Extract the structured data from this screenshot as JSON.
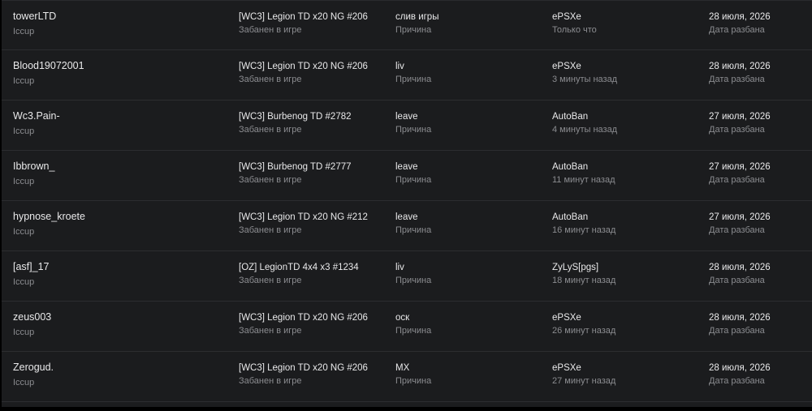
{
  "colors": {
    "background": "#000000",
    "panel": "#1b1c1e",
    "text_primary": "#e9e9ea",
    "text_secondary": "#8b8c90",
    "divider": "#2c2d30"
  },
  "bans": [
    {
      "player": "towerLTD",
      "server": "Iccup",
      "game": "[WC3] Legion TD x20 NG #206",
      "game_status": "Забанен в игре",
      "reason": "слив игры",
      "reason_label": "Причина",
      "admin": "ePSXe",
      "time_ago": "Только что",
      "date": "28 июля, 2026",
      "date_label": "Дата разбана"
    },
    {
      "player": "Blood19072001",
      "server": "Iccup",
      "game": "[WC3] Legion TD x20 NG #206",
      "game_status": "Забанен в игре",
      "reason": "liv",
      "reason_label": "Причина",
      "admin": "ePSXe",
      "time_ago": "3 минуты назад",
      "date": "28 июля, 2026",
      "date_label": "Дата разбана"
    },
    {
      "player": "Wc3.Pain-",
      "server": "Iccup",
      "game": "[WC3] Burbenog TD #2782",
      "game_status": "Забанен в игре",
      "reason": "leave",
      "reason_label": "Причина",
      "admin": "AutoBan",
      "time_ago": "4 минуты назад",
      "date": "27 июля, 2026",
      "date_label": "Дата разбана"
    },
    {
      "player": "Ibbrown_",
      "server": "Iccup",
      "game": "[WC3] Burbenog TD #2777",
      "game_status": "Забанен в игре",
      "reason": "leave",
      "reason_label": "Причина",
      "admin": "AutoBan",
      "time_ago": "11 минут назад",
      "date": "27 июля, 2026",
      "date_label": "Дата разбана"
    },
    {
      "player": "hypnose_kroete",
      "server": "Iccup",
      "game": "[WC3] Legion TD x20 NG #212",
      "game_status": "Забанен в игре",
      "reason": "leave",
      "reason_label": "Причина",
      "admin": "AutoBan",
      "time_ago": "16 минут назад",
      "date": "27 июля, 2026",
      "date_label": "Дата разбана"
    },
    {
      "player": "[asf]_17",
      "server": "Iccup",
      "game": "[OZ] LegionTD 4x4 x3 #1234",
      "game_status": "Забанен в игре",
      "reason": "liv",
      "reason_label": "Причина",
      "admin": "ZyLyS[pgs]",
      "time_ago": "18 минут назад",
      "date": "28 июля, 2026",
      "date_label": "Дата разбана"
    },
    {
      "player": "zeus003",
      "server": "Iccup",
      "game": "[WC3] Legion TD x20 NG #206",
      "game_status": "Забанен в игре",
      "reason": "оск",
      "reason_label": "Причина",
      "admin": "ePSXe",
      "time_ago": "26 минут назад",
      "date": "28 июля, 2026",
      "date_label": "Дата разбана"
    },
    {
      "player": "Zerogud.",
      "server": "Iccup",
      "game": "[WC3] Legion TD x20 NG #206",
      "game_status": "Забанен в игре",
      "reason": "MX",
      "reason_label": "Причина",
      "admin": "ePSXe",
      "time_ago": "27 минут назад",
      "date": "28 июля, 2026",
      "date_label": "Дата разбана"
    }
  ]
}
